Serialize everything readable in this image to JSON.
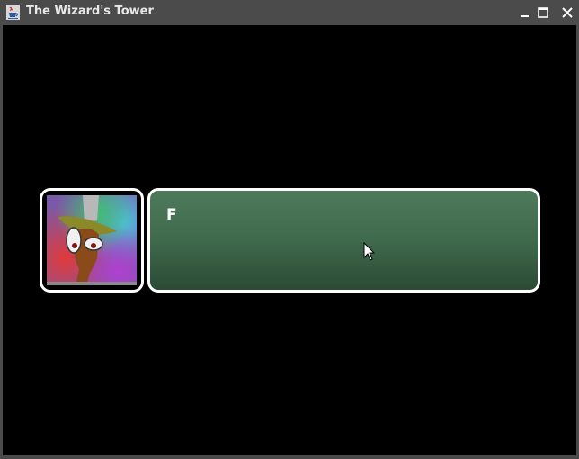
{
  "window": {
    "title": "The Wizard's Tower",
    "app_icon": "java-cup-icon",
    "controls": [
      "minimize-icon",
      "maximize-icon",
      "close-icon"
    ]
  },
  "dialog": {
    "portrait": "wizard-portrait",
    "text": "F"
  },
  "colors": {
    "background": "#000000",
    "dialog_top": "#4e7a5c",
    "dialog_bottom": "#2b4a35",
    "border": "#ffffff"
  }
}
